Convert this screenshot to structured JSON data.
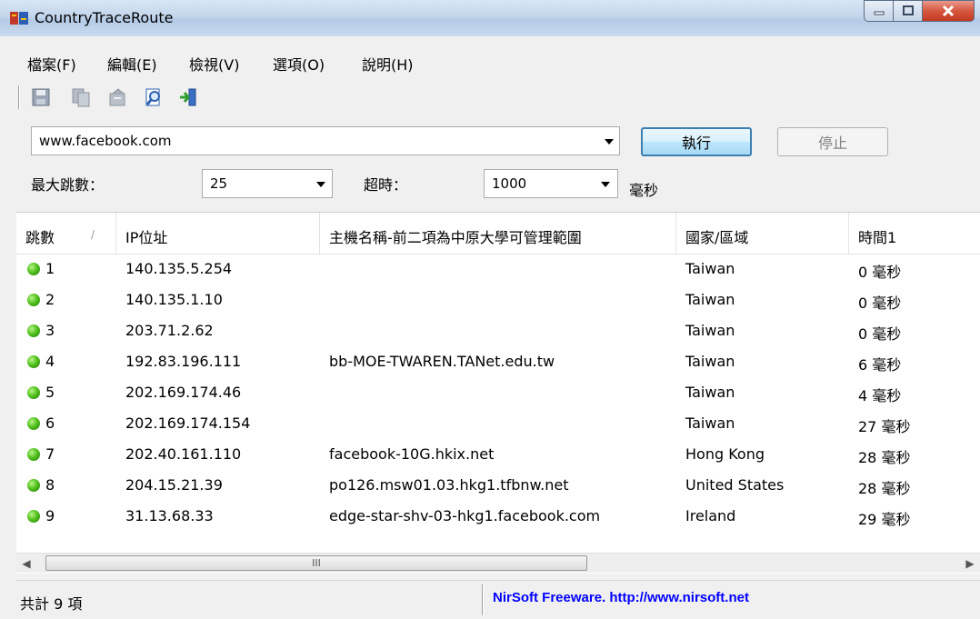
{
  "window": {
    "title": "CountryTraceRoute"
  },
  "menu": [
    "檔案(F)",
    "編輯(E)",
    "檢視(V)",
    "選項(O)",
    "說明(H)"
  ],
  "toolbar": {
    "icons": [
      "save-icon",
      "copy-icon",
      "properties-icon",
      "find-icon",
      "exit-icon"
    ]
  },
  "target": {
    "value": "www.facebook.com"
  },
  "buttons": {
    "run": "執行",
    "stop": "停止"
  },
  "options": {
    "max_hops_label": "最大跳數：",
    "max_hops_value": "25",
    "timeout_label": "超時：",
    "timeout_value": "1000",
    "timeout_unit": "毫秒"
  },
  "table": {
    "columns": [
      "跳數",
      "IP位址",
      "主機名稱-前二項為中原大學可管理範圍",
      "國家/區域",
      "時間1"
    ],
    "rows": [
      {
        "hop": "1",
        "ip": "140.135.5.254",
        "host": "",
        "country": "Taiwan",
        "time": "0 毫秒"
      },
      {
        "hop": "2",
        "ip": "140.135.1.10",
        "host": "",
        "country": "Taiwan",
        "time": "0 毫秒"
      },
      {
        "hop": "3",
        "ip": "203.71.2.62",
        "host": "",
        "country": "Taiwan",
        "time": "0 毫秒"
      },
      {
        "hop": "4",
        "ip": "192.83.196.111",
        "host": "bb-MOE-TWAREN.TANet.edu.tw",
        "country": "Taiwan",
        "time": "6 毫秒"
      },
      {
        "hop": "5",
        "ip": "202.169.174.46",
        "host": "",
        "country": "Taiwan",
        "time": "4 毫秒"
      },
      {
        "hop": "6",
        "ip": "202.169.174.154",
        "host": "",
        "country": "Taiwan",
        "time": "27 毫秒"
      },
      {
        "hop": "7",
        "ip": "202.40.161.110",
        "host": "facebook-10G.hkix.net",
        "country": "Hong Kong",
        "time": "28 毫秒"
      },
      {
        "hop": "8",
        "ip": "204.15.21.39",
        "host": "po126.msw01.03.hkg1.tfbnw.net",
        "country": "United States",
        "time": "28 毫秒"
      },
      {
        "hop": "9",
        "ip": "31.13.68.33",
        "host": "edge-star-shv-03-hkg1.facebook.com",
        "country": "Ireland",
        "time": "29 毫秒"
      }
    ]
  },
  "scrollbar": {
    "thumb_grip": "III"
  },
  "status": {
    "count": "共計 9 項",
    "credit": "NirSoft Freeware.  http://www.nirsoft.net"
  },
  "colors": {
    "status_ok": "#54c21f",
    "credit_link": "#0000ff",
    "run_button_border": "#3c7fb1"
  }
}
